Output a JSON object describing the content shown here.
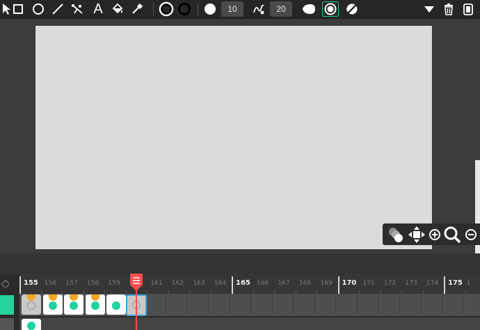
{
  "toolbar": {
    "tools": [
      {
        "name": "select-tool",
        "icon": "pointer-icon"
      },
      {
        "name": "rectangle-tool",
        "icon": "square-icon"
      },
      {
        "name": "ellipse-tool",
        "icon": "circle-icon"
      },
      {
        "name": "line-tool",
        "icon": "line-icon"
      },
      {
        "name": "path-tool",
        "icon": "path-edit-icon"
      },
      {
        "name": "text-tool",
        "icon": "text-icon",
        "label": "A"
      },
      {
        "name": "fill-tool",
        "icon": "paint-bucket-icon"
      },
      {
        "name": "eyedropper-tool",
        "icon": "eyedropper-icon"
      }
    ],
    "brush_size": "10",
    "smoothing": "20",
    "colors": {
      "accent": "#26c9a3",
      "background": "#262626",
      "field": "#4a4a4a"
    }
  },
  "timeline": {
    "ruler_labels": [
      "155",
      "156",
      "157",
      "158",
      "159",
      "160",
      "161",
      "162",
      "163",
      "164",
      "165",
      "166",
      "167",
      "168",
      "169",
      "170",
      "171",
      "172",
      "173",
      "174",
      "175",
      "1"
    ],
    "major_labels": [
      "155",
      "165",
      "170",
      "175"
    ],
    "current_frame": "160",
    "playhead_color": "#ff4d4d",
    "layer_color": "#26d39e"
  }
}
